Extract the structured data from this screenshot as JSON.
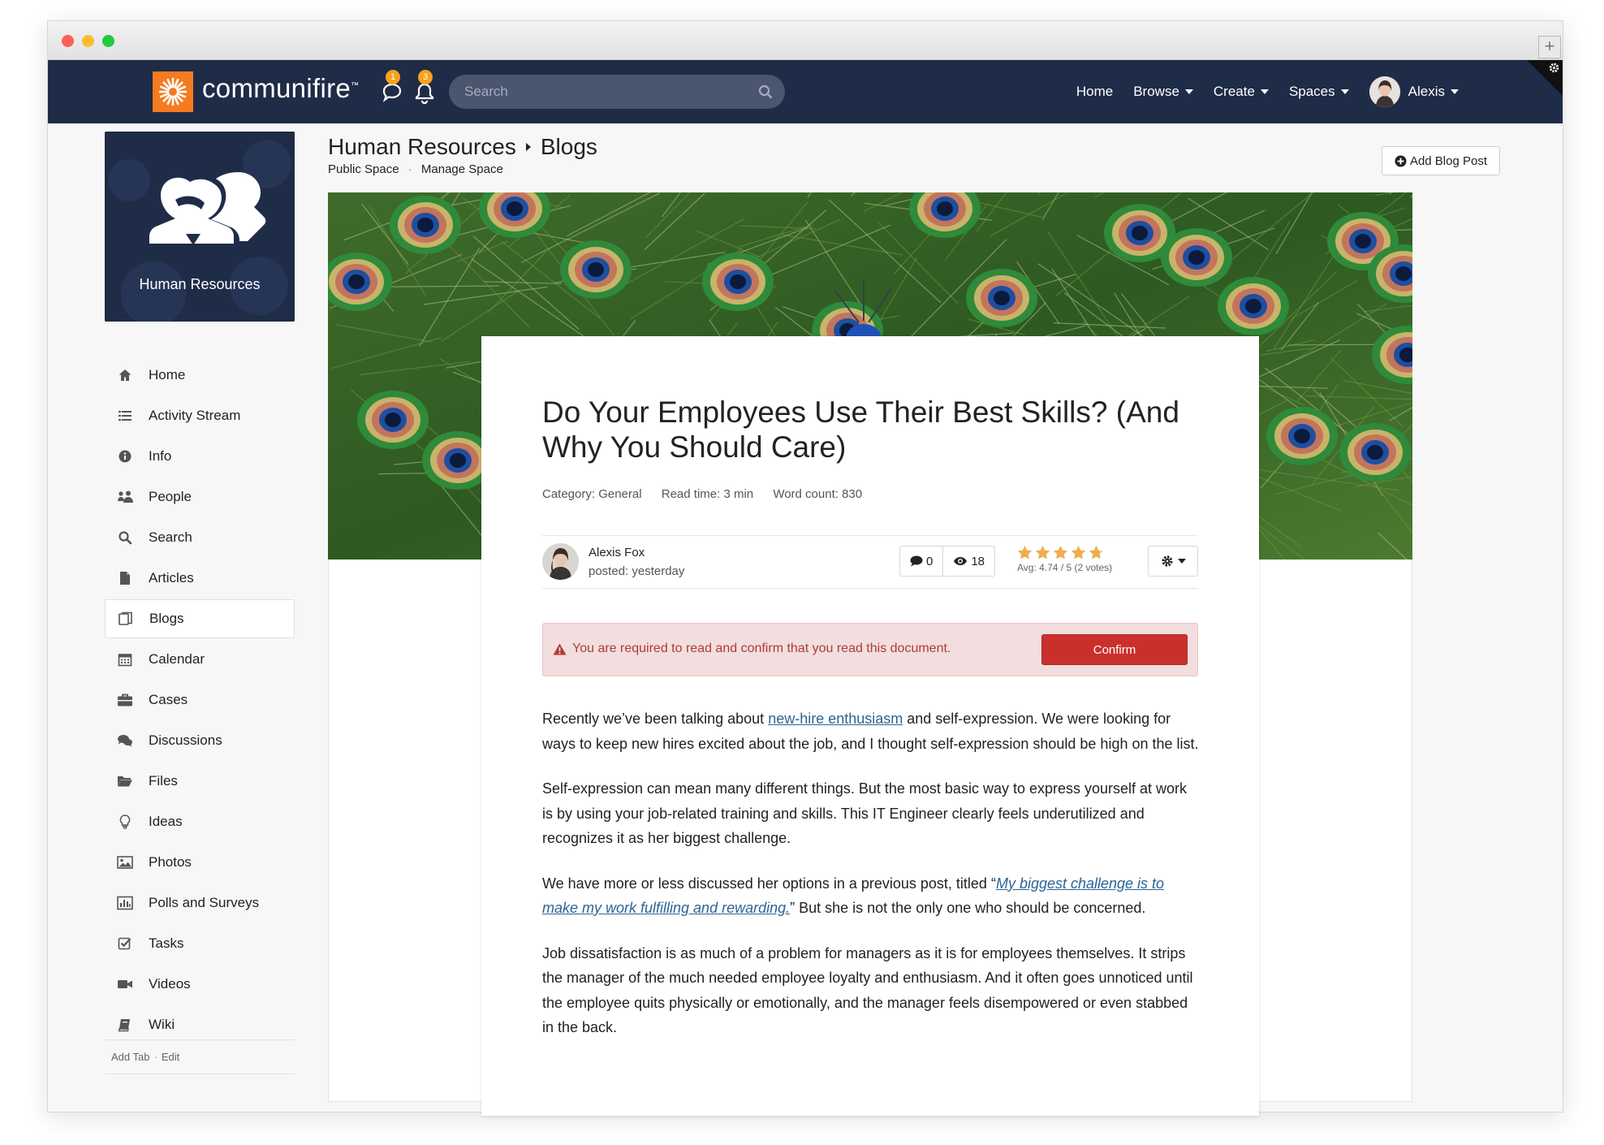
{
  "brand": {
    "name": "communifire",
    "tm": "™"
  },
  "header": {
    "messages_count": "1",
    "notifications_count": "3",
    "search_placeholder": "Search",
    "nav": [
      "Home",
      "Browse",
      "Create",
      "Spaces"
    ],
    "user_name": "Alexis"
  },
  "sidebar": {
    "space_name": "Human Resources",
    "items": [
      {
        "label": "Home",
        "icon": "home-icon"
      },
      {
        "label": "Activity Stream",
        "icon": "list-icon"
      },
      {
        "label": "Info",
        "icon": "info-icon"
      },
      {
        "label": "People",
        "icon": "people-icon"
      },
      {
        "label": "Search",
        "icon": "search-icon"
      },
      {
        "label": "Articles",
        "icon": "document-icon"
      },
      {
        "label": "Blogs",
        "icon": "blogs-icon"
      },
      {
        "label": "Calendar",
        "icon": "calendar-icon"
      },
      {
        "label": "Cases",
        "icon": "briefcase-icon"
      },
      {
        "label": "Discussions",
        "icon": "comments-icon"
      },
      {
        "label": "Files",
        "icon": "folder-icon"
      },
      {
        "label": "Ideas",
        "icon": "lightbulb-icon"
      },
      {
        "label": "Photos",
        "icon": "image-icon"
      },
      {
        "label": "Polls and Surveys",
        "icon": "bar-chart-icon"
      },
      {
        "label": "Tasks",
        "icon": "checkbox-icon"
      },
      {
        "label": "Videos",
        "icon": "video-icon"
      },
      {
        "label": "Wiki",
        "icon": "book-icon"
      }
    ],
    "active_item": "Blogs",
    "footer_add": "Add Tab",
    "footer_edit": "Edit"
  },
  "page": {
    "breadcrumb_space": "Human Resources",
    "breadcrumb_section": "Blogs",
    "space_type": "Public Space",
    "manage_link": "Manage Space",
    "add_button": "Add Blog Post"
  },
  "article": {
    "title": "Do Your Employees Use Their Best Skills? (And Why You Should Care)",
    "category": "Category: General",
    "read_time": "Read time: 3 min",
    "word_count": "Word count: 830",
    "author": "Alexis Fox",
    "posted": "posted: yesterday",
    "comments": "0",
    "views": "18",
    "rating": 4.74,
    "rating_text": "Avg: 4.74 / 5 (2 votes)",
    "alert_text": "You are required to read and confirm that you read this document.",
    "confirm_label": "Confirm",
    "p1_before": "Recently we’ve been talking about ",
    "p1_link": "new-hire enthusiasm",
    "p1_after": " and self-expression. We were looking for ways to keep new hires excited about the job, and I thought self-expression should be high on the list.",
    "p2": "Self-expression can mean many different things. But the most basic way to express yourself at work is by using your job-related training and skills. This IT Engineer clearly feels underutilized and recognizes it as her biggest challenge.",
    "p3_before": "We have more or less discussed her options in a previous post, titled “",
    "p3_link": "My biggest challenge is to make my work fulfilling and rewarding.",
    "p3_after": "” But she is not the only one who should be concerned.",
    "p4": "Job dissatisfaction is as much of a problem for managers as it is for employees themselves. It strips the manager of the much needed employee loyalty and enthusiasm. And it often goes unnoticed until the employee quits physically or emotionally, and the manager feels disempowered or even stabbed in the back."
  },
  "colors": {
    "navbar": "#1f2c48",
    "brand_orange": "#f47b20",
    "badge": "#f7a21b",
    "confirm": "#c9302c",
    "alert_bg": "#f2dede",
    "link": "#2a6496",
    "star": "#f0ad4e"
  }
}
